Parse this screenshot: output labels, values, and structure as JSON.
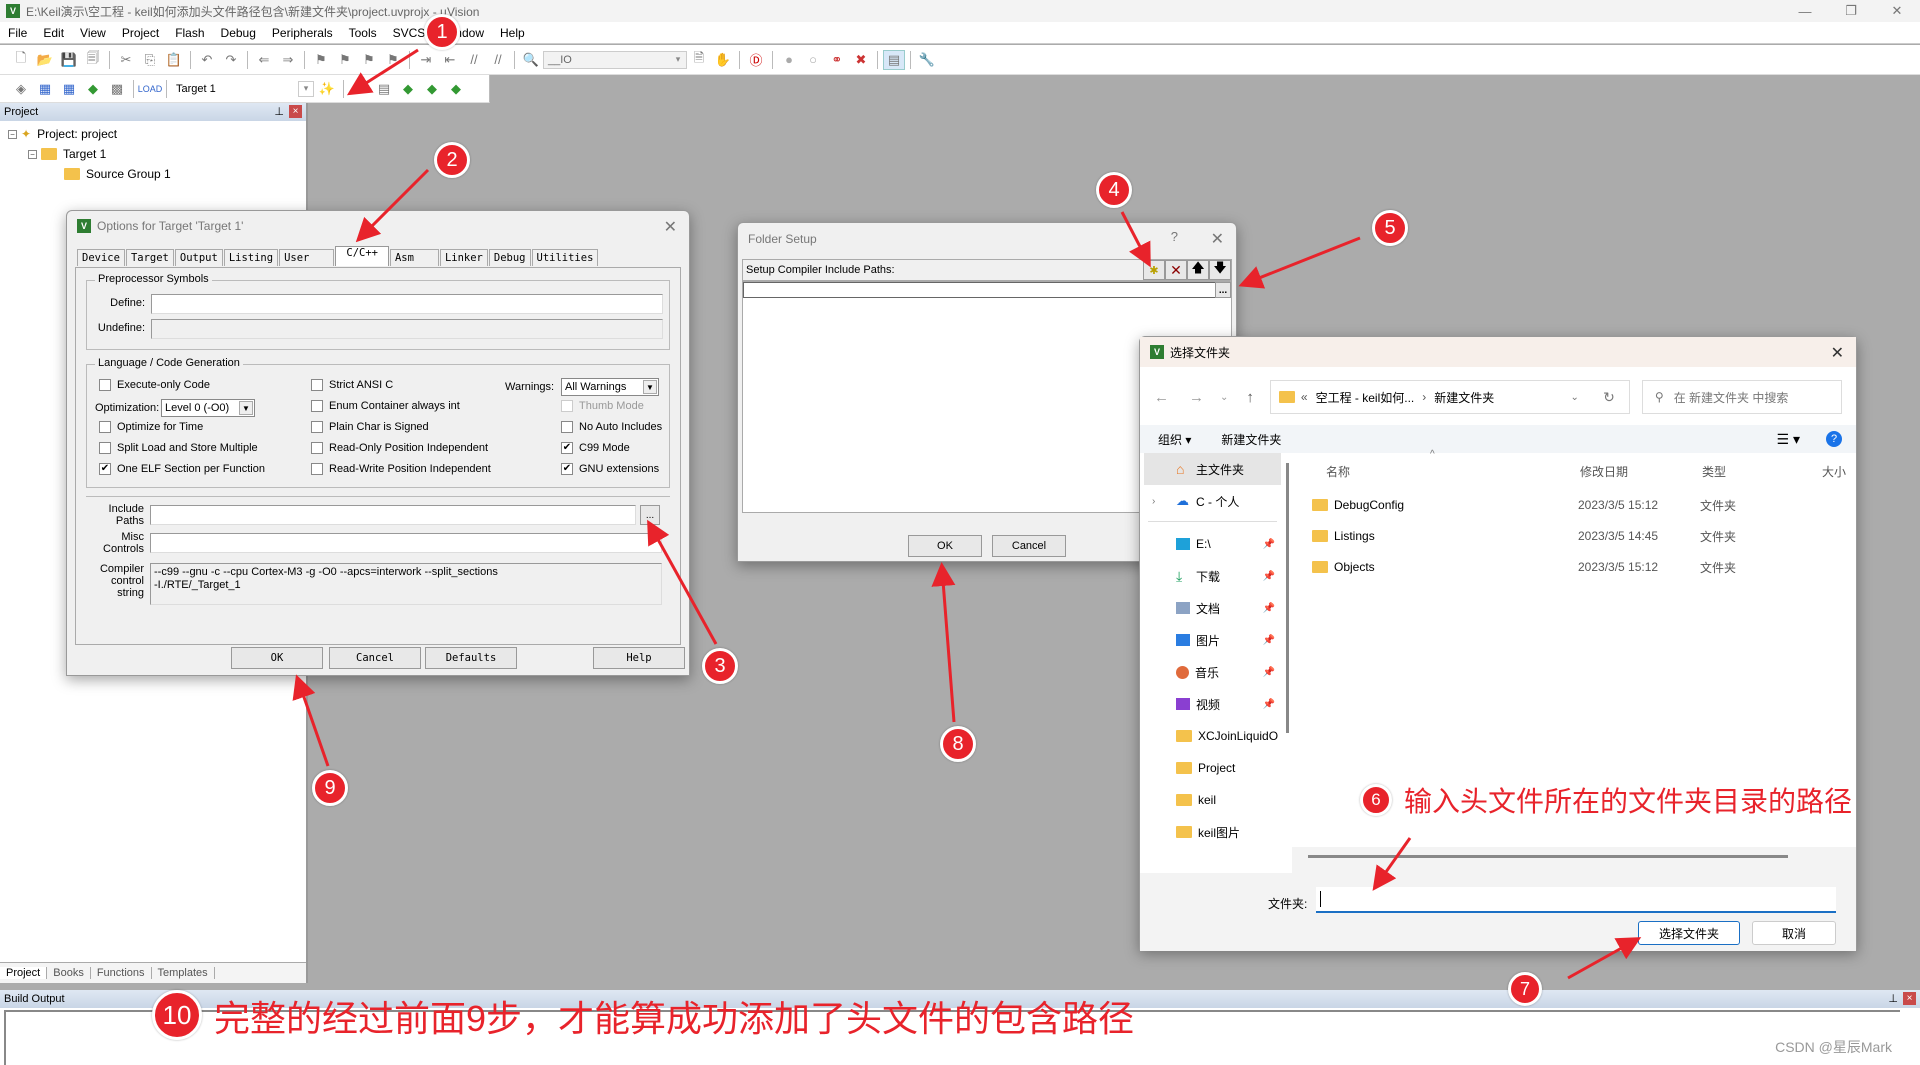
{
  "window": {
    "title": "E:\\Keil演示\\空工程 - keil如何添加头文件路径包含\\新建文件夹\\project.uvprojx - µVision",
    "app_icon": "uvision-icon",
    "controls": {
      "minimize": "—",
      "maximize": "❐",
      "close": "✕"
    }
  },
  "menu": [
    "File",
    "Edit",
    "View",
    "Project",
    "Flash",
    "Debug",
    "Peripherals",
    "Tools",
    "SVCS",
    "Window",
    "Help"
  ],
  "toolbar": {
    "search_combo_value": "__IO",
    "target_combo_value": "Target 1"
  },
  "project_panel": {
    "header": "Project",
    "tree": [
      {
        "label": "Project: project",
        "level": 0
      },
      {
        "label": "Target 1",
        "level": 1
      },
      {
        "label": "Source Group 1",
        "level": 2
      }
    ],
    "tabs": [
      {
        "label": "Project",
        "active": true
      },
      {
        "label": "Books",
        "active": false
      },
      {
        "label": "Functions",
        "active": false
      },
      {
        "label": "Templates",
        "active": false
      }
    ]
  },
  "build_output": {
    "header": "Build Output",
    "watermark": "CSDN @星辰Mark"
  },
  "options_dialog": {
    "title": "Options for Target 'Target 1'",
    "tabs": [
      "Device",
      "Target",
      "Output",
      "Listing",
      "User",
      "C/C++",
      "Asm",
      "Linker",
      "Debug",
      "Utilities"
    ],
    "active_tab": "C/C++",
    "preprocessor": {
      "group_label": "Preprocessor Symbols",
      "define_label": "Define:",
      "define_value": "",
      "undefine_label": "Undefine:",
      "undefine_value": ""
    },
    "language": {
      "group_label": "Language / Code Generation",
      "col1": [
        {
          "label": "Execute-only Code",
          "checked": false
        },
        {
          "label": "Optimize for Time",
          "checked": false
        },
        {
          "label": "Split Load and Store Multiple",
          "checked": false
        },
        {
          "label": "One ELF Section per Function",
          "checked": true
        }
      ],
      "optimization_label": "Optimization:",
      "optimization_value": "Level 0 (-O0)",
      "col2": [
        {
          "label": "Strict ANSI C",
          "checked": false
        },
        {
          "label": "Enum Container always int",
          "checked": false
        },
        {
          "label": "Plain Char is Signed",
          "checked": false
        },
        {
          "label": "Read-Only Position Independent",
          "checked": false
        },
        {
          "label": "Read-Write Position Independent",
          "checked": false
        }
      ],
      "warnings_label": "Warnings:",
      "warnings_value": "All Warnings",
      "col3": [
        {
          "label": "Thumb Mode",
          "checked": false,
          "disabled": true
        },
        {
          "label": "No Auto Includes",
          "checked": false
        },
        {
          "label": "C99 Mode",
          "checked": true
        },
        {
          "label": "GNU extensions",
          "checked": true
        }
      ]
    },
    "include_paths_label": "Include\nPaths",
    "include_paths_value": "",
    "browse_label": "...",
    "misc_controls_label": "Misc\nControls",
    "misc_controls_value": "",
    "compiler_string_label": "Compiler\ncontrol\nstring",
    "compiler_string_lines": [
      "--c99 --gnu -c --cpu Cortex-M3 -g -O0 --apcs=interwork --split_sections",
      "-I./RTE/_Target_1"
    ],
    "buttons": {
      "ok": "OK",
      "cancel": "Cancel",
      "defaults": "Defaults",
      "help": "Help"
    }
  },
  "folder_setup": {
    "title": "Folder Setup",
    "help": "?",
    "label": "Setup Compiler Include Paths:",
    "tools": [
      "new-folder-icon",
      "delete-icon",
      "move-up-icon",
      "move-down-icon"
    ],
    "path_value": "",
    "browse_label": "...",
    "buttons": {
      "ok": "OK",
      "cancel": "Cancel"
    }
  },
  "file_chooser": {
    "title": "选择文件夹",
    "breadcrumb": [
      "«",
      "空工程 - keil如何...",
      "›",
      "新建文件夹"
    ],
    "search_placeholder": "在 新建文件夹 中搜索",
    "organize": "组织 ▾",
    "new_folder": "新建文件夹",
    "nav": [
      {
        "label": "主文件夹",
        "icon": "home-icon",
        "selected": true
      },
      {
        "label": "C - 个人",
        "icon": "cloud-icon",
        "expand": true
      },
      {
        "label": "E:\\",
        "icon": "drive-icon",
        "pinned": true
      },
      {
        "label": "下载",
        "icon": "download-icon",
        "pinned": true
      },
      {
        "label": "文档",
        "icon": "document-icon",
        "pinned": true
      },
      {
        "label": "图片",
        "icon": "picture-icon",
        "pinned": true
      },
      {
        "label": "音乐",
        "icon": "music-icon",
        "pinned": true
      },
      {
        "label": "视频",
        "icon": "video-icon",
        "pinned": true
      },
      {
        "label": "XCJoinLiquidO",
        "icon": "folder-icon"
      },
      {
        "label": "Project",
        "icon": "folder-icon"
      },
      {
        "label": "keil",
        "icon": "folder-icon"
      },
      {
        "label": "keil图片",
        "icon": "folder-icon"
      }
    ],
    "columns": [
      "名称",
      "修改日期",
      "类型",
      "大小"
    ],
    "files": [
      {
        "name": "DebugConfig",
        "date": "2023/3/5 15:12",
        "type": "文件夹"
      },
      {
        "name": "Listings",
        "date": "2023/3/5 14:45",
        "type": "文件夹"
      },
      {
        "name": "Objects",
        "date": "2023/3/5 15:12",
        "type": "文件夹"
      }
    ],
    "folder_label": "文件夹:",
    "folder_value": "",
    "select_button": "选择文件夹",
    "cancel_button": "取消"
  },
  "annotations": {
    "steps": [
      "1",
      "2",
      "3",
      "4",
      "5",
      "6",
      "7",
      "8",
      "9",
      "10"
    ],
    "note6": "输入头文件所在的文件夹目录的路径",
    "note10": "完整的经过前面9步，才能算成功添加了头文件的包含路径",
    "color": "#e8232b"
  }
}
